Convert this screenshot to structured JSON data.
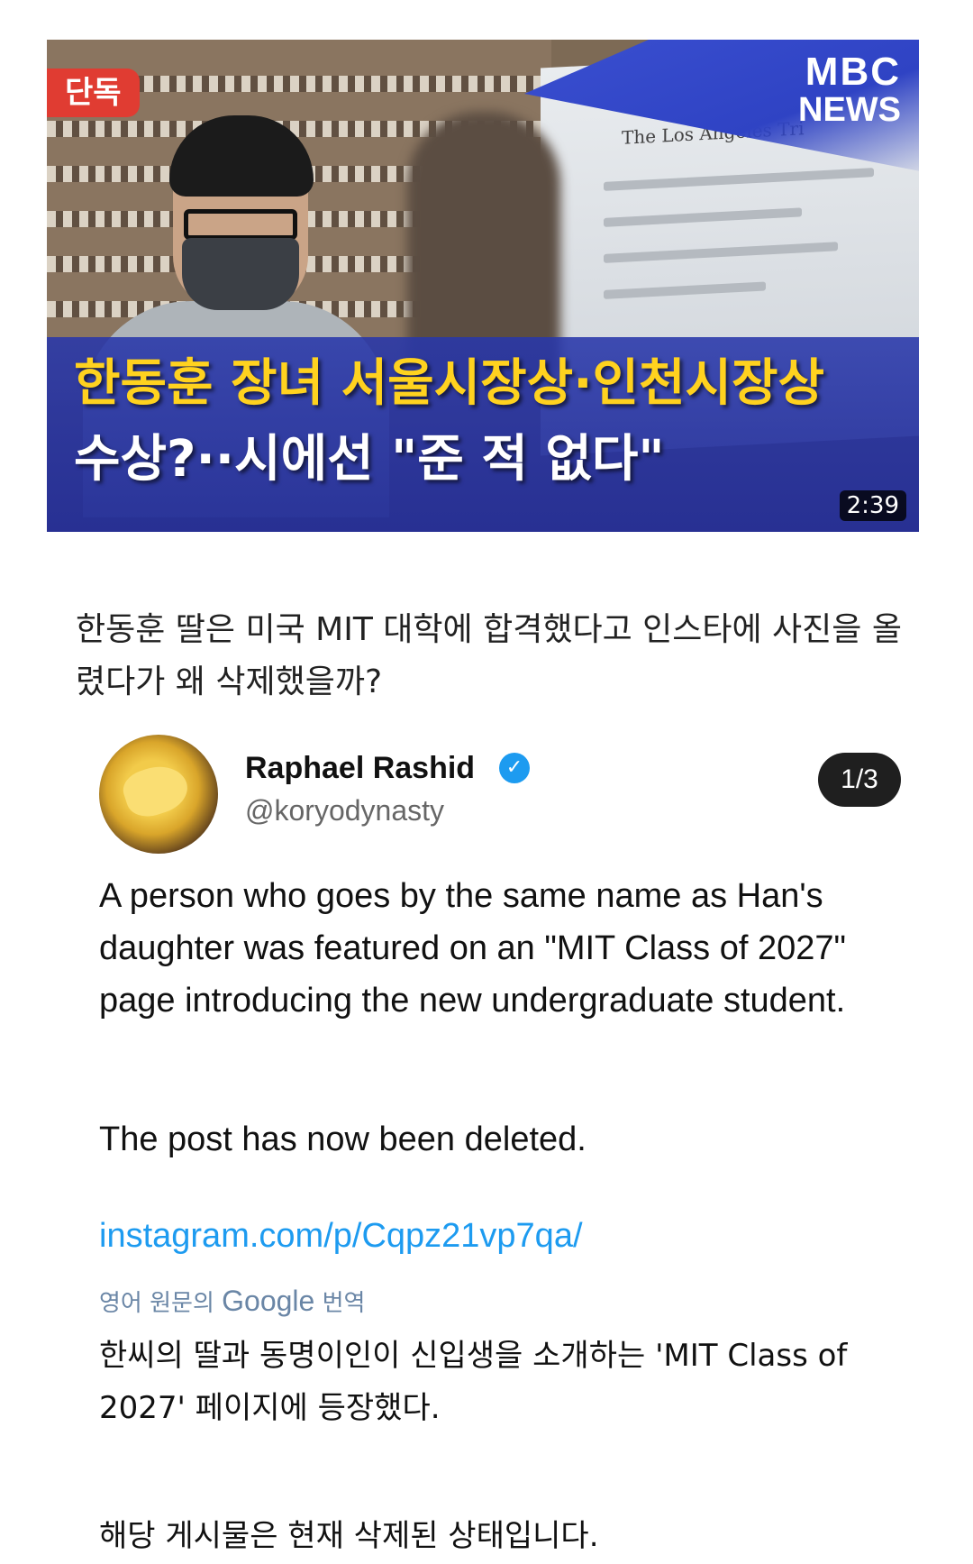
{
  "video": {
    "badge": "단독",
    "brand_top": "MBC",
    "brand_bottom": "NEWS",
    "background_paper": "The Los Angeles Tri",
    "headline_line1": "한동훈 장녀 서울시장상·인천시장상",
    "headline_line2": "수상?··시에선 \"준 적 없다\"",
    "duration": "2:39",
    "colors": {
      "badge": "#e03c32",
      "headline_highlight": "#ffd21f",
      "band": "#2f43c4"
    }
  },
  "post": {
    "text": "한동훈 딸은 미국 MIT 대학에 합격했다고 인스타에 사진을 올렸다가 왜 삭제했을까?"
  },
  "tweet": {
    "author_name": "Raphael Rashid",
    "verified_icon": "✓",
    "handle": "@koryodynasty",
    "thread_counter": "1/3",
    "paragraph1": "A person who goes by the same name as Han's daughter was featured on an \"MIT Class of 2027\" page introducing the new undergraduate student.",
    "paragraph2": "The post has now been deleted.",
    "link": "instagram.com/p/Cqpz21vp7qa/",
    "translate_prefix": "영어 원문의",
    "translate_brand": "Google",
    "translate_suffix": "번역",
    "translation_paragraph1": "한씨의 딸과 동명이인이 신입생을 소개하는 'MIT Class of 2027' 페이지에 등장했다.",
    "translation_paragraph2": "해당 게시물은 현재 삭제된 상태입니다.",
    "colors": {
      "link": "#1d9bf0",
      "verified": "#1d9bf0"
    }
  }
}
